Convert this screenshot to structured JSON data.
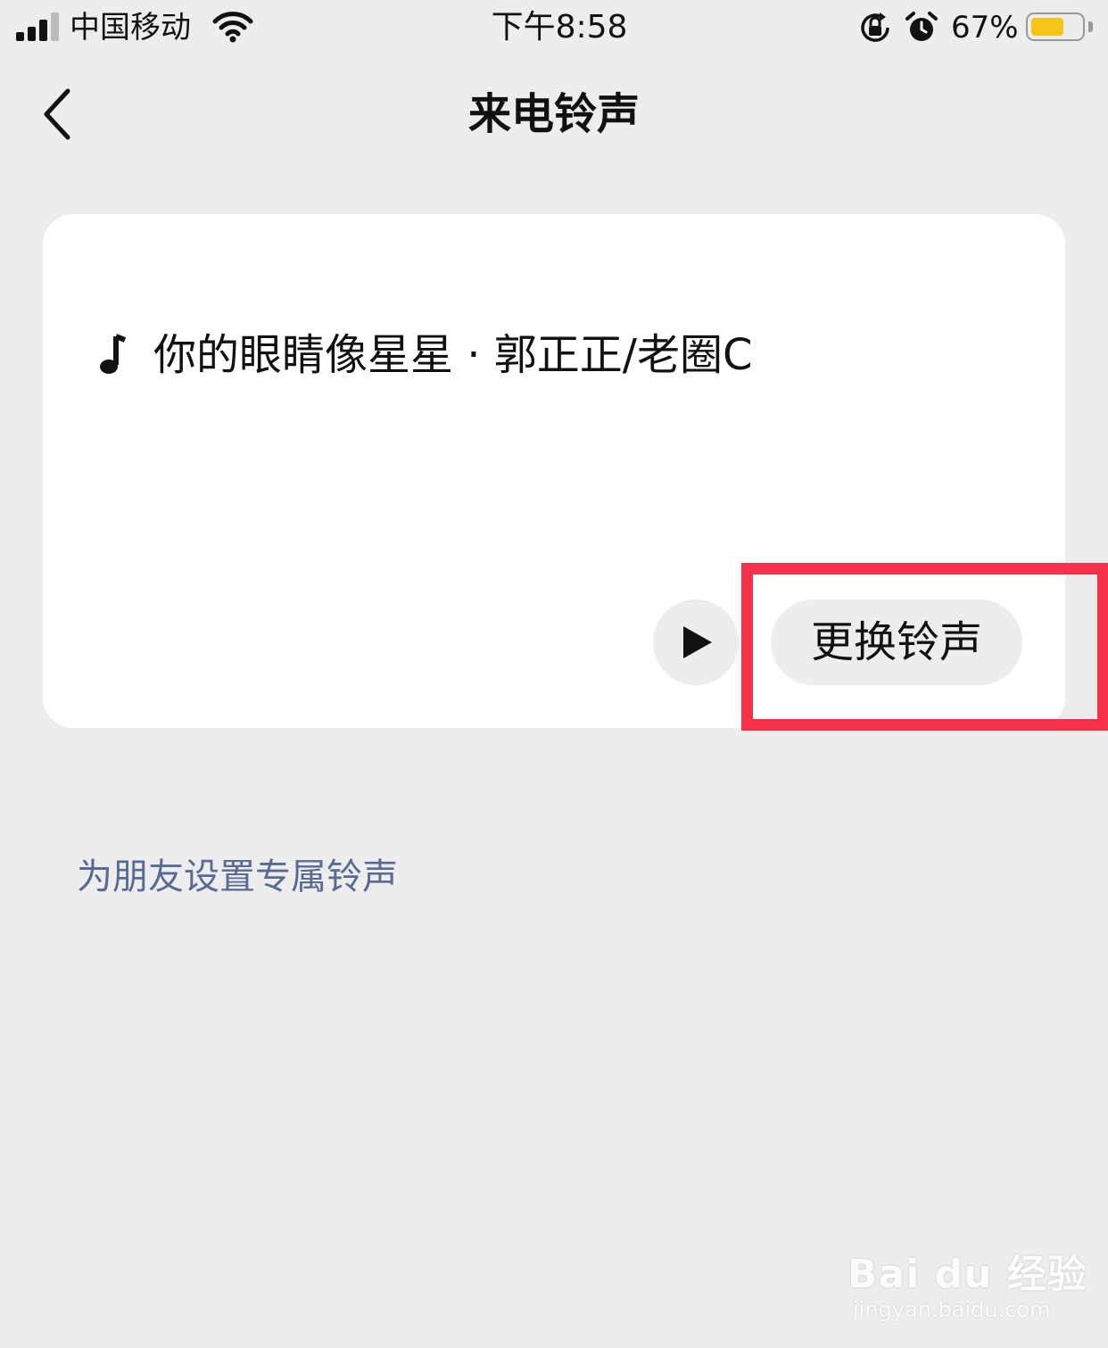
{
  "status_bar": {
    "carrier": "中国移动",
    "time": "下午8:58",
    "battery_percent": "67%",
    "battery_level": 0.67,
    "signal_bars_active": 3,
    "battery_color": "#f5c518"
  },
  "nav": {
    "back_icon": "chevron-left-icon",
    "title": "来电铃声"
  },
  "ringtone_card": {
    "song": "你的眼睛像星星 · 郭正正/老圈C",
    "play_icon": "play-icon",
    "change_button_label": "更换铃声"
  },
  "friend_ringtone_link": "为朋友设置专属铃声",
  "annotation": {
    "highlight_color": "#f53049"
  },
  "watermark": {
    "logo": "Bai du 经验",
    "url": "jingyan.baidu.com"
  },
  "colors": {
    "background": "#ededed",
    "card": "#ffffff",
    "link": "#576b95"
  }
}
